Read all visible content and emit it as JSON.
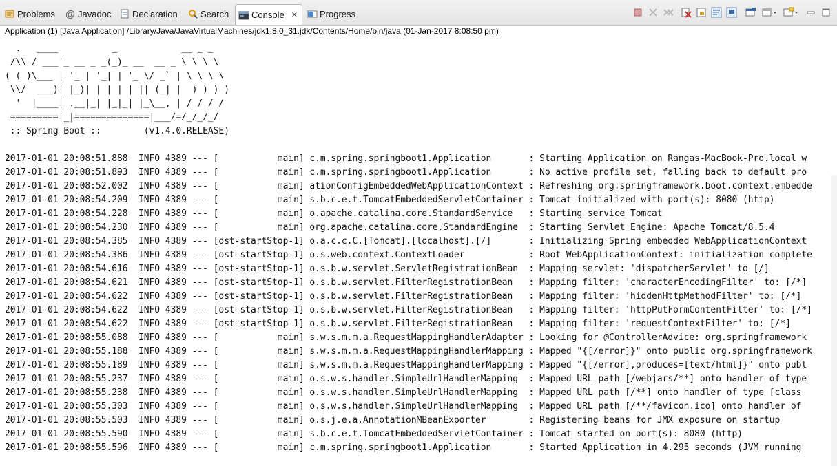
{
  "tabs": [
    {
      "label": "Problems"
    },
    {
      "label": "Javadoc"
    },
    {
      "label": "Declaration"
    },
    {
      "label": "Search"
    },
    {
      "label": "Console"
    },
    {
      "label": "Progress"
    }
  ],
  "toolbar_icons": [
    "terminate-icon",
    "remove-launch-icon",
    "remove-all-icon",
    "clear-console-icon",
    "scroll-lock-icon",
    "word-wrap-icon",
    "pin-console-icon",
    "display-selected-icon",
    "open-console-icon",
    "minimize-icon",
    "maximize-icon"
  ],
  "path": "Application (1) [Java Application] /Library/Java/JavaVirtualMachines/jdk1.8.0_31.jdk/Contents/Home/bin/java (01-Jan-2017 8:08:50 pm)",
  "console_text": "  .   ____          _            __ _ _\n /\\\\ / ___'_ __ _ _(_)_ __  __ _ \\ \\ \\ \\\n( ( )\\___ | '_ | '_| | '_ \\/ _` | \\ \\ \\ \\\n \\\\/  ___)| |_)| | | | | || (_| |  ) ) ) )\n  '  |____| .__|_| |_|_| |_\\__, | / / / /\n =========|_|==============|___/=/_/_/_/\n :: Spring Boot ::        (v1.4.0.RELEASE)\n\n2017-01-01 20:08:51.888  INFO 4389 --- [           main] c.m.spring.springboot1.Application       : Starting Application on Rangas-MacBook-Pro.local w\n2017-01-01 20:08:51.893  INFO 4389 --- [           main] c.m.spring.springboot1.Application       : No active profile set, falling back to default pro\n2017-01-01 20:08:52.002  INFO 4389 --- [           main] ationConfigEmbeddedWebApplicationContext : Refreshing org.springframework.boot.context.embedde\n2017-01-01 20:08:54.209  INFO 4389 --- [           main] s.b.c.e.t.TomcatEmbeddedServletContainer : Tomcat initialized with port(s): 8080 (http)\n2017-01-01 20:08:54.228  INFO 4389 --- [           main] o.apache.catalina.core.StandardService   : Starting service Tomcat\n2017-01-01 20:08:54.230  INFO 4389 --- [           main] org.apache.catalina.core.StandardEngine  : Starting Servlet Engine: Apache Tomcat/8.5.4\n2017-01-01 20:08:54.385  INFO 4389 --- [ost-startStop-1] o.a.c.c.C.[Tomcat].[localhost].[/]       : Initializing Spring embedded WebApplicationContext\n2017-01-01 20:08:54.386  INFO 4389 --- [ost-startStop-1] o.s.web.context.ContextLoader            : Root WebApplicationContext: initialization complete\n2017-01-01 20:08:54.616  INFO 4389 --- [ost-startStop-1] o.s.b.w.servlet.ServletRegistrationBean  : Mapping servlet: 'dispatcherServlet' to [/]\n2017-01-01 20:08:54.621  INFO 4389 --- [ost-startStop-1] o.s.b.w.servlet.FilterRegistrationBean   : Mapping filter: 'characterEncodingFilter' to: [/*]\n2017-01-01 20:08:54.622  INFO 4389 --- [ost-startStop-1] o.s.b.w.servlet.FilterRegistrationBean   : Mapping filter: 'hiddenHttpMethodFilter' to: [/*]\n2017-01-01 20:08:54.622  INFO 4389 --- [ost-startStop-1] o.s.b.w.servlet.FilterRegistrationBean   : Mapping filter: 'httpPutFormContentFilter' to: [/*]\n2017-01-01 20:08:54.622  INFO 4389 --- [ost-startStop-1] o.s.b.w.servlet.FilterRegistrationBean   : Mapping filter: 'requestContextFilter' to: [/*]\n2017-01-01 20:08:55.088  INFO 4389 --- [           main] s.w.s.m.m.a.RequestMappingHandlerAdapter : Looking for @ControllerAdvice: org.springframework\n2017-01-01 20:08:55.188  INFO 4389 --- [           main] s.w.s.m.m.a.RequestMappingHandlerMapping : Mapped \"{[/error]}\" onto public org.springframework\n2017-01-01 20:08:55.189  INFO 4389 --- [           main] s.w.s.m.m.a.RequestMappingHandlerMapping : Mapped \"{[/error],produces=[text/html]}\" onto publ\n2017-01-01 20:08:55.237  INFO 4389 --- [           main] o.s.w.s.handler.SimpleUrlHandlerMapping  : Mapped URL path [/webjars/**] onto handler of type\n2017-01-01 20:08:55.238  INFO 4389 --- [           main] o.s.w.s.handler.SimpleUrlHandlerMapping  : Mapped URL path [/**] onto handler of type [class \n2017-01-01 20:08:55.303  INFO 4389 --- [           main] o.s.w.s.handler.SimpleUrlHandlerMapping  : Mapped URL path [/**/favicon.ico] onto handler of \n2017-01-01 20:08:55.503  INFO 4389 --- [           main] o.s.j.e.a.AnnotationMBeanExporter        : Registering beans for JMX exposure on startup\n2017-01-01 20:08:55.590  INFO 4389 --- [           main] s.b.c.e.t.TomcatEmbeddedServletContainer : Tomcat started on port(s): 8080 (http)\n2017-01-01 20:08:55.596  INFO 4389 --- [           main] c.m.spring.springboot1.Application       : Started Application in 4.295 seconds (JVM running"
}
